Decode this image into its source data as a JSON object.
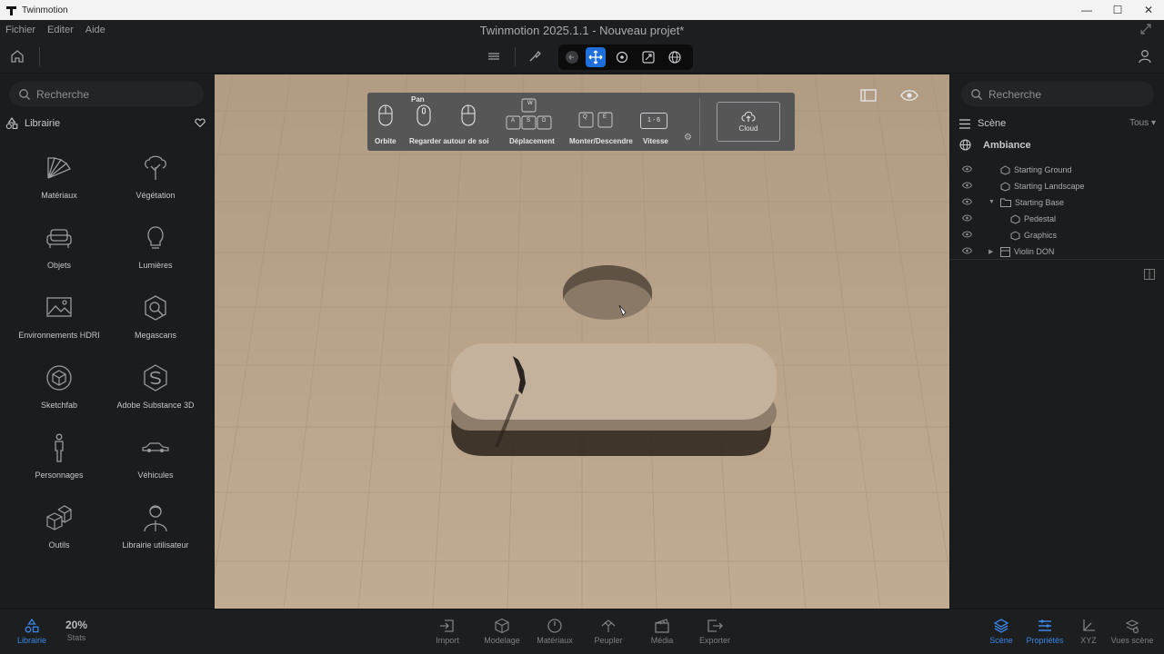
{
  "os_window": {
    "title": "Twinmotion",
    "minimize": "—",
    "maximize": "☐",
    "close": "✕"
  },
  "menu": {
    "items": [
      "Fichier",
      "Editer",
      "Aide"
    ],
    "app_title": "Twinmotion 2025.1.1 - Nouveau projet*"
  },
  "toolbar": {
    "icons": [
      "home-icon",
      "layers-icon",
      "brush-icon",
      "back-icon",
      "move-icon",
      "orbit-icon",
      "expand-icon",
      "globe-icon",
      "user-icon"
    ],
    "active_tool": "move",
    "accent": "#1e6fd9"
  },
  "left_panel": {
    "search_placeholder": "Recherche",
    "library_title": "Librairie",
    "items": [
      {
        "label": "Matériaux",
        "icon": "materials-fan-icon"
      },
      {
        "label": "Végétation",
        "icon": "tree-icon"
      },
      {
        "label": "Objets",
        "icon": "sofa-icon"
      },
      {
        "label": "Lumières",
        "icon": "bulb-icon"
      },
      {
        "label": "Environnements HDRI",
        "icon": "hdri-image-icon"
      },
      {
        "label": "Megascans",
        "icon": "megascans-icon"
      },
      {
        "label": "Sketchfab",
        "icon": "sketchfab-icon"
      },
      {
        "label": "Adobe Substance 3D",
        "icon": "substance-icon"
      },
      {
        "label": "Personnages",
        "icon": "person-icon"
      },
      {
        "label": "Véhicules",
        "icon": "car-icon"
      },
      {
        "label": "Outils",
        "icon": "cubes-icon"
      },
      {
        "label": "Librairie utilisateur",
        "icon": "user-library-icon"
      }
    ]
  },
  "nav_help": {
    "pan_label": "Pan",
    "orbit": "Orbite",
    "look": "Regarder autour de soi",
    "move": "Déplacement",
    "up_down": "Monter/Descendre",
    "speed": "Vitesse",
    "speed_keys": "1 - 6",
    "keys": {
      "w": "W",
      "a": "A",
      "s": "S",
      "d": "D",
      "q": "Q",
      "e": "E"
    },
    "cloud": "Cloud"
  },
  "right_panel": {
    "search_placeholder": "Recherche",
    "scene_title": "Scène",
    "filter": "Tous",
    "ambiance": "Ambiance",
    "tree": [
      {
        "label": "Starting Ground",
        "level": 1,
        "expandable": false
      },
      {
        "label": "Starting Landscape",
        "level": 1,
        "expandable": false
      },
      {
        "label": "Starting Base",
        "level": 1,
        "expandable": true,
        "expanded": true
      },
      {
        "label": "Pedestal",
        "level": 2,
        "expandable": false
      },
      {
        "label": "Graphics",
        "level": 2,
        "expandable": false
      },
      {
        "label": "Violin DON",
        "level": 1,
        "expandable": true,
        "expanded": false
      }
    ]
  },
  "bottom": {
    "library": "Librairie",
    "stats_value": "20%",
    "stats": "Stats",
    "center": [
      "Import",
      "Modelage",
      "Matériaux",
      "Peupler",
      "Média",
      "Exporter"
    ],
    "right": [
      "Scène",
      "Propriétés",
      "XYZ",
      "Vues scène"
    ],
    "active_color": "#3b86e6"
  }
}
